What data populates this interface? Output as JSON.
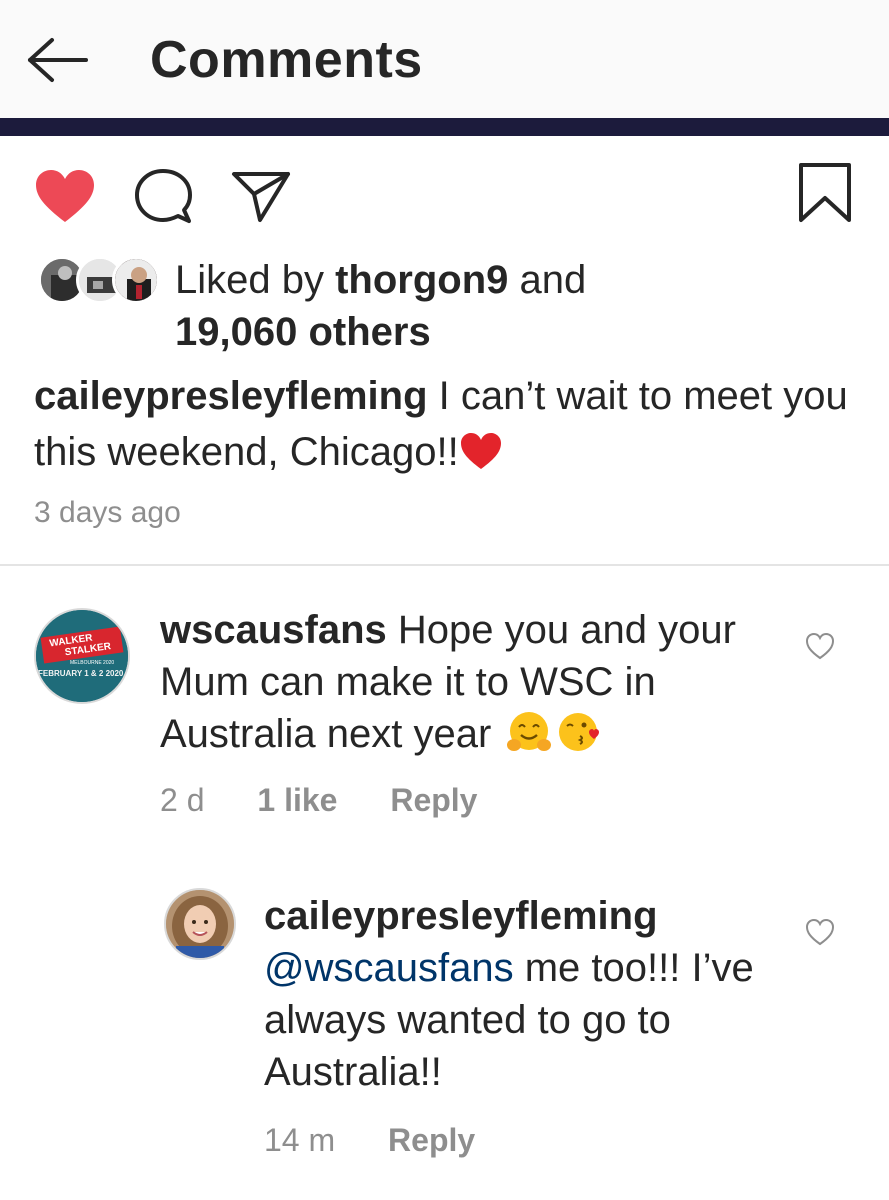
{
  "header": {
    "title": "Comments"
  },
  "post": {
    "liked_by_prefix": "Liked by",
    "liked_by_user": "thorgon9",
    "liked_by_and": "and",
    "others_count": "19,060 others",
    "caption_user": "caileypresleyfleming",
    "caption_text": "I can’t wait to meet you this weekend, Chicago!!",
    "time_ago": "3 days ago"
  },
  "comments": [
    {
      "user": "wscausfans",
      "text": "Hope you and your Mum can make it to WSC in Australia next year",
      "avatar_text": [
        "WALKER",
        "STALKER",
        "MELBOURNE 2020",
        "FEBRUARY 1 & 2 2020"
      ],
      "time": "2 d",
      "likes": "1 like",
      "reply_label": "Reply"
    },
    {
      "user": "caileypresleyfleming",
      "mention": "@wscausfans",
      "text": "me too!!! I’ve always wanted to go to Australia!!",
      "time": "14 m",
      "reply_label": "Reply"
    }
  ],
  "colors": {
    "like_red": "#ed4956",
    "header_bar": "#1c1b3c",
    "meta_gray": "#8e8e8e",
    "mention_blue": "#003569"
  },
  "icons": [
    "back-arrow-icon",
    "heart-filled-icon",
    "comment-icon",
    "share-icon",
    "bookmark-icon",
    "heart-outline-icon"
  ]
}
